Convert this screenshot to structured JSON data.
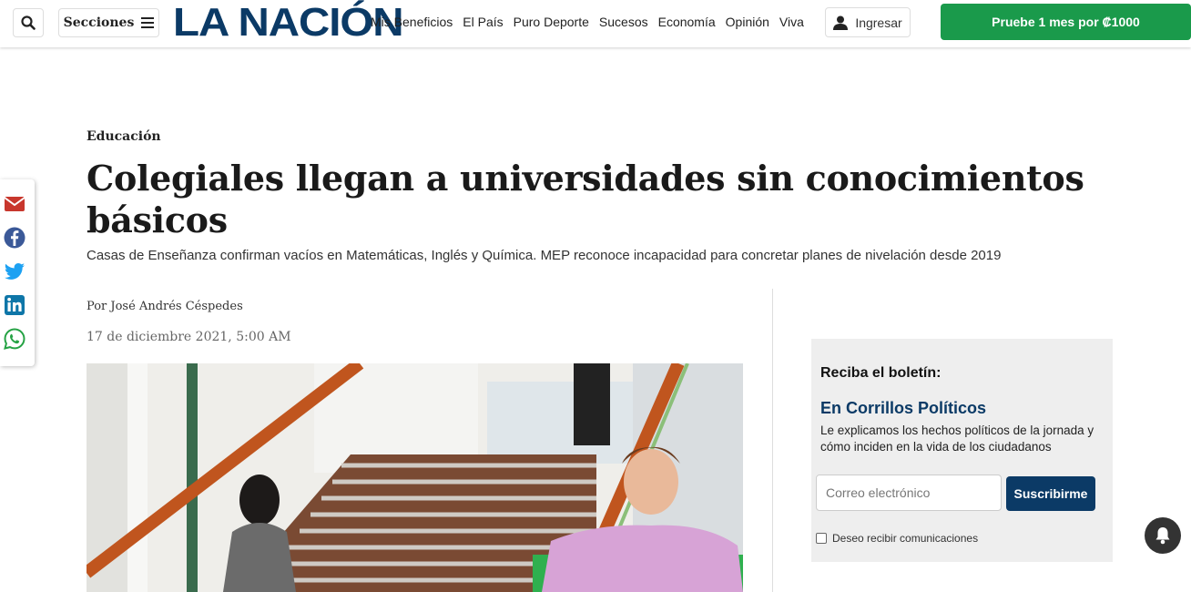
{
  "header": {
    "sections_label": "Secciones",
    "logo_text": "LA NACIÓN",
    "nav": [
      "Mis Beneficios",
      "El País",
      "Puro Deporte",
      "Sucesos",
      "Economía",
      "Opinión",
      "Viva"
    ],
    "login_label": "Ingresar",
    "trial_label": "Pruebe 1 mes por ₡1000"
  },
  "article": {
    "category": "Educación",
    "headline": "Colegiales llegan a universidades sin conocimientos básicos",
    "subhead": "Casas de Enseñanza confirman vacíos en Matemáticas, Inglés y Química. MEP reconoce incapacidad para concretar planes de nivelación desde 2019",
    "byline": "Por José Andrés Céspedes",
    "date": "17 de diciembre 2021, 5:00 AM"
  },
  "share": {
    "icons": [
      "email-icon",
      "facebook-icon",
      "twitter-icon",
      "linkedin-icon",
      "whatsapp-icon"
    ]
  },
  "newsletter": {
    "title": "Reciba el boletín:",
    "name": "En Corrillos Políticos",
    "description": "Le explicamos los hechos políticos de la jornada y cómo inciden en la vida de los ciudadanos",
    "email_placeholder": "Correo electrónico",
    "subscribe_label": "Suscribirme",
    "checkbox_label": "Deseo recibir comunicaciones"
  },
  "colors": {
    "brand_blue": "#0b3a66",
    "trial_green": "#1a9a4b"
  }
}
